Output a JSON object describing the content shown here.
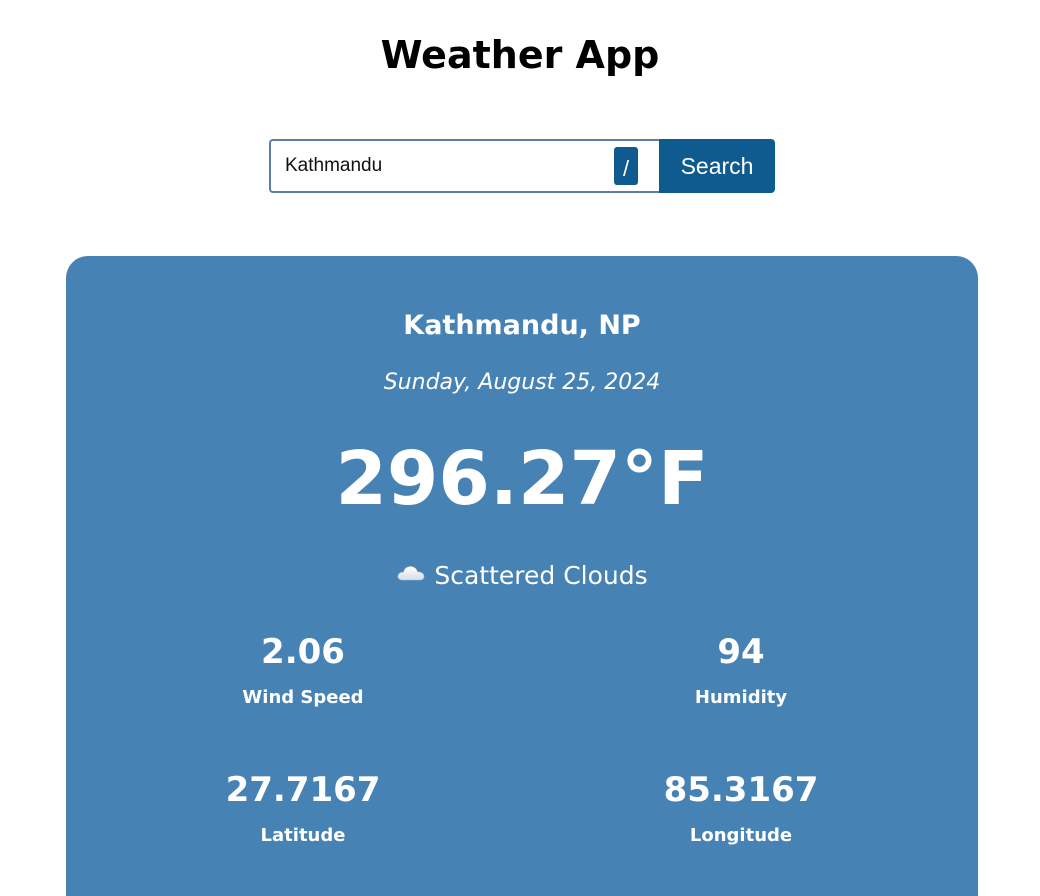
{
  "app": {
    "title": "Weather App"
  },
  "search": {
    "value": "Kathmandu",
    "shortcut_key": "/",
    "button_label": "Search"
  },
  "weather": {
    "location": "Kathmandu, NP",
    "date": "Sunday, August 25, 2024",
    "temperature": "296.27°F",
    "condition": "Scattered Clouds",
    "condition_icon": "cloud-icon",
    "stats": {
      "wind_speed": {
        "value": "2.06",
        "label": "Wind Speed"
      },
      "humidity": {
        "value": "94",
        "label": "Humidity"
      },
      "latitude": {
        "value": "27.7167",
        "label": "Latitude"
      },
      "longitude": {
        "value": "85.3167",
        "label": "Longitude"
      }
    }
  },
  "colors": {
    "card_background": "#4682b4",
    "accent": "#0f5a8e",
    "input_border": "#5b7fa8"
  }
}
